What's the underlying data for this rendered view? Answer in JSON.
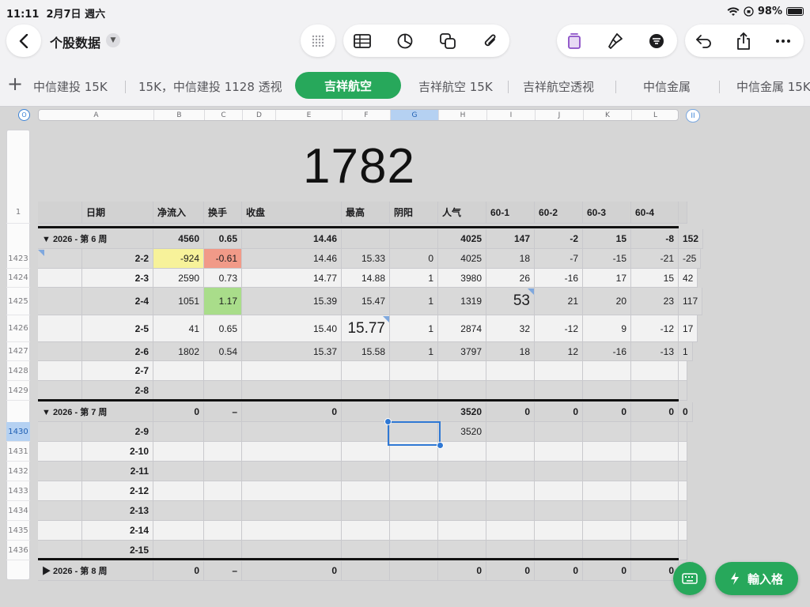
{
  "status": {
    "time": "11:11",
    "date": "2月7日 週六",
    "battery": "98%"
  },
  "toolbar": {
    "document_title": "个股数据",
    "icons": [
      "back-chevron-icon",
      "grid-dots-icon",
      "table-icon",
      "chart-icon",
      "shapes-icon",
      "attachment-icon",
      "format-icon",
      "brush-icon",
      "organize-icon",
      "undo-icon",
      "share-icon",
      "more-icon"
    ]
  },
  "tabs": [
    "中信建投 15K",
    "15K，中信建投 1128 透视",
    "吉祥航空",
    "吉祥航空 15K",
    "吉祥航空透视",
    "中信金属",
    "中信金属 15K"
  ],
  "active_tab_index": 2,
  "sheet": {
    "big_value": "1782",
    "corner_label": "O",
    "freeze_label": "II",
    "column_letters": [
      "A",
      "B",
      "C",
      "D",
      "E",
      "F",
      "G",
      "H",
      "I",
      "J",
      "K",
      "L"
    ],
    "selected_column": "G",
    "header_row_number": "1",
    "headers": [
      "",
      "日期",
      "净流入",
      "换手",
      "收盘",
      "最高",
      "阴阳",
      "人气",
      "60-1",
      "60-2",
      "60-3",
      "60-4",
      ""
    ],
    "groups": [
      {
        "label": "▼  2026 - 第 6 周",
        "totals": [
          "4560",
          "0.65",
          "14.46",
          "",
          "",
          "4025",
          "147",
          "-2",
          "15",
          "-8",
          "152"
        ],
        "rows": [
          {
            "num": "1423",
            "date": "2-2",
            "cells": [
              "-924",
              "-0.61",
              "14.46",
              "15.33",
              "0",
              "4025",
              "18",
              "-7",
              "-15",
              "-21",
              "-25"
            ]
          },
          {
            "num": "1424",
            "date": "2-3",
            "cells": [
              "2590",
              "0.73",
              "14.77",
              "14.88",
              "1",
              "3980",
              "26",
              "-16",
              "17",
              "15",
              "42"
            ]
          },
          {
            "num": "1425",
            "date": "2-4",
            "cells": [
              "1051",
              "1.17",
              "15.39",
              "15.47",
              "1",
              "1319",
              "53",
              "21",
              "20",
              "23",
              "117"
            ]
          },
          {
            "num": "1426",
            "date": "2-5",
            "cells": [
              "41",
              "0.65",
              "15.40",
              "15.77",
              "1",
              "2874",
              "32",
              "-12",
              "9",
              "-12",
              "17"
            ]
          },
          {
            "num": "1427",
            "date": "2-6",
            "cells": [
              "1802",
              "0.54",
              "15.37",
              "15.58",
              "1",
              "3797",
              "18",
              "12",
              "-16",
              "-13",
              "1"
            ]
          },
          {
            "num": "1428",
            "date": "2-7",
            "cells": [
              "",
              "",
              "",
              "",
              "",
              "",
              "",
              "",
              "",
              "",
              ""
            ]
          },
          {
            "num": "1429",
            "date": "2-8",
            "cells": [
              "",
              "",
              "",
              "",
              "",
              "",
              "",
              "",
              "",
              "",
              ""
            ]
          }
        ]
      },
      {
        "label": "▼  2026 - 第 7 周",
        "totals": [
          "0",
          "–",
          "0",
          "",
          "",
          "3520",
          "0",
          "0",
          "0",
          "0",
          "0"
        ],
        "rows": [
          {
            "num": "1430",
            "date": "2-9",
            "cells": [
              "",
              "",
              "",
              "",
              "",
              "3520",
              "",
              "",
              "",
              "",
              ""
            ]
          },
          {
            "num": "1431",
            "date": "2-10",
            "cells": [
              "",
              "",
              "",
              "",
              "",
              "",
              "",
              "",
              "",
              "",
              ""
            ]
          },
          {
            "num": "1432",
            "date": "2-11",
            "cells": [
              "",
              "",
              "",
              "",
              "",
              "",
              "",
              "",
              "",
              "",
              ""
            ]
          },
          {
            "num": "1433",
            "date": "2-12",
            "cells": [
              "",
              "",
              "",
              "",
              "",
              "",
              "",
              "",
              "",
              "",
              ""
            ]
          },
          {
            "num": "1434",
            "date": "2-13",
            "cells": [
              "",
              "",
              "",
              "",
              "",
              "",
              "",
              "",
              "",
              "",
              ""
            ]
          },
          {
            "num": "1435",
            "date": "2-14",
            "cells": [
              "",
              "",
              "",
              "",
              "",
              "",
              "",
              "",
              "",
              "",
              ""
            ]
          },
          {
            "num": "1436",
            "date": "2-15",
            "cells": [
              "",
              "",
              "",
              "",
              "",
              "",
              "",
              "",
              "",
              "",
              ""
            ]
          }
        ]
      },
      {
        "label": "▶  2026 - 第 8 周",
        "totals": [
          "0",
          "–",
          "0",
          "",
          "",
          "0",
          "0",
          "0",
          "0",
          "0",
          "0"
        ],
        "rows": []
      }
    ],
    "selected_row": "1430",
    "highlights": {
      "yellow": "#f7f29a",
      "red": "#f19a88",
      "green": "#a9dd8a"
    },
    "accent": "#27a85b"
  },
  "bottom": {
    "enter_label": "輸入格"
  }
}
